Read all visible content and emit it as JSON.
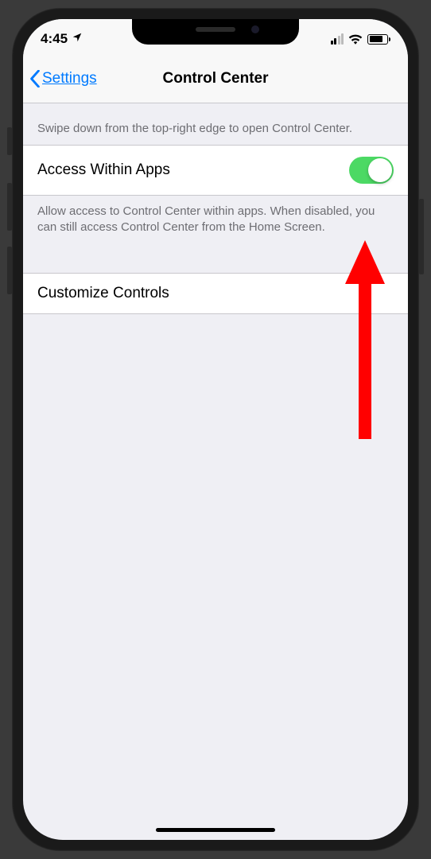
{
  "statusBar": {
    "time": "4:45"
  },
  "nav": {
    "backLabel": "Settings",
    "title": "Control Center"
  },
  "sections": {
    "headerText": "Swipe down from the top-right edge to open Control Center.",
    "accessRow": {
      "label": "Access Within Apps",
      "enabled": true
    },
    "footerText": "Allow access to Control Center within apps. When disabled, you can still access Control Center from the Home Screen.",
    "customizeRow": {
      "label": "Customize Controls"
    }
  },
  "colors": {
    "tint": "#007aff",
    "switchOn": "#4cd964",
    "groupBg": "#efeff4",
    "separator": "#c8c7cc",
    "annotation": "#ff0000"
  }
}
